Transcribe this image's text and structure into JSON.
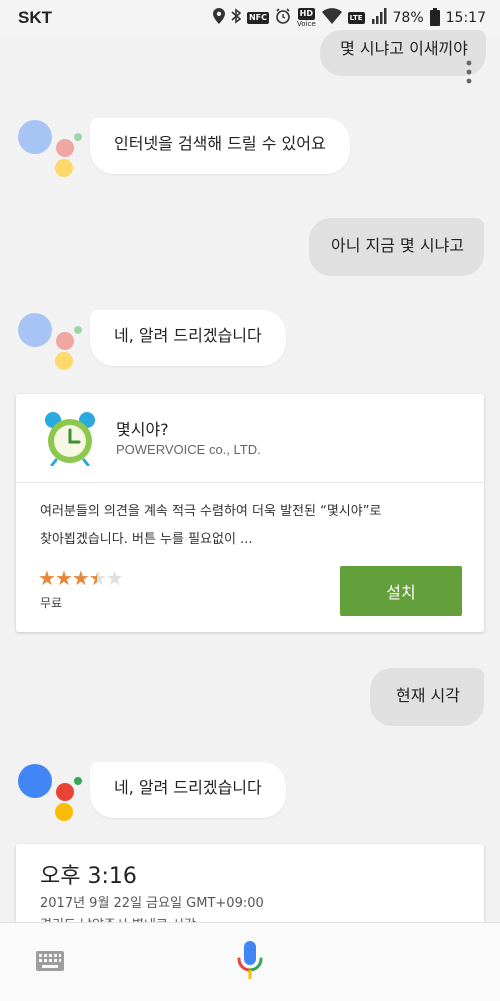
{
  "status_bar": {
    "carrier": "SKT",
    "hd_label": "HD",
    "hd_sub": "Voice",
    "nfc_label": "NFC",
    "lte_label": "LTE",
    "battery": "78%",
    "time": "15:17"
  },
  "conversation": {
    "user_1": "몇 시냐고 이새끼야",
    "assistant_1": "인터넷을 검색해 드릴 수 있어요",
    "user_2": "아니 지금 몇 시냐고",
    "assistant_2": "네, 알려 드리겠습니다",
    "user_3": "현재 시각",
    "assistant_3": "네, 알려 드리겠습니다"
  },
  "app_card": {
    "title": "몇시야?",
    "developer": "POWERVOICE co., LTD.",
    "description_line1": "여러분들의 의견을 계속 적극 수렴하여 더욱 발전된 “몇시야”로",
    "description_line2": "찾아뵙겠습니다. 버튼 누를 필요없이 ...",
    "rating": 3.5,
    "rating_max": 5,
    "price": "무료",
    "install_label": "설치"
  },
  "time_card": {
    "time": "오후 3:16",
    "date": "2017년 9월 22일 금요일 GMT+09:00",
    "location": "경기도 남양주시 별내로 시각"
  },
  "colors": {
    "install_button": "#639f3a",
    "star": "#e8873b",
    "mic_blue": "#4285f4",
    "mic_red": "#ea4335",
    "mic_yellow": "#fbbc05",
    "mic_green": "#34a853"
  },
  "icons": [
    "location-icon",
    "bluetooth-icon",
    "alarm-icon",
    "wifi-icon",
    "signal-icon",
    "battery-icon",
    "more-vert-icon",
    "alarm-clock-app-icon",
    "keyboard-icon",
    "mic-icon"
  ]
}
